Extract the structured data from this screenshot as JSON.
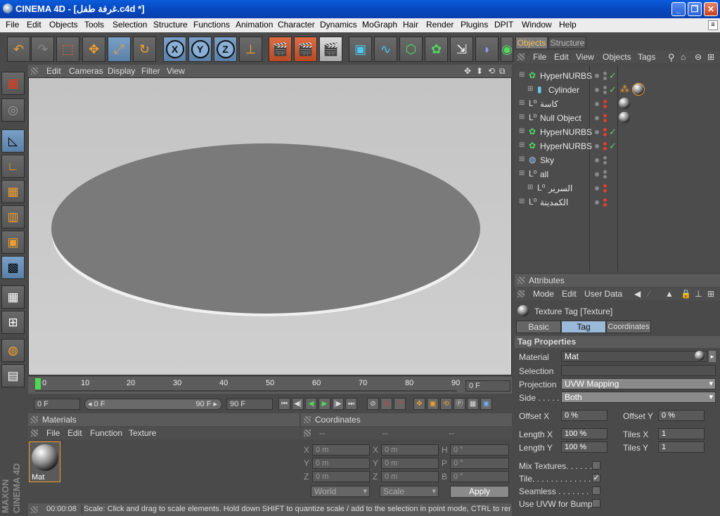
{
  "window": {
    "title": "CINEMA 4D - [غرفة طفل.c4d *]",
    "min": "_",
    "max": "❐",
    "close": "✕"
  },
  "menu": [
    "File",
    "Edit",
    "Objects",
    "Tools",
    "Selection",
    "Structure",
    "Functions",
    "Animation",
    "Character",
    "Dynamics",
    "MoGraph",
    "Hair",
    "Render",
    "Plugins",
    "DPIT",
    "Window",
    "Help"
  ],
  "menu_mini": "≡",
  "toolbar": {
    "undo": "↶",
    "redo": "↷",
    "select": "⬚",
    "move": "✥",
    "scale": "⤢",
    "rotate": "↻",
    "x": "X",
    "y": "Y",
    "z": "Z",
    "coord": "⊥",
    "render1": "🎬",
    "render2": "🎬",
    "render3": "🎬",
    "cube": "▣",
    "spline": "∿",
    "nurbs": "⬡",
    "array": "✿",
    "deformer": "⇲",
    "scene": "◗",
    "more": "◉"
  },
  "lefttools": [
    "▦",
    "◎",
    "◺",
    "∟",
    "▦",
    "▥",
    "▣",
    "▩",
    "▦",
    "⊞",
    "◍",
    "▤"
  ],
  "branding": "MAXON CINEMA 4D",
  "viewport": {
    "menu": [
      "Edit",
      "Cameras",
      "Display",
      "Filter",
      "View"
    ],
    "controls": [
      "✥",
      "⬍",
      "⟲",
      "⧉"
    ]
  },
  "timeline": {
    "ticks": [
      "0",
      "10",
      "20",
      "30",
      "40",
      "50",
      "60",
      "70",
      "80",
      "90"
    ],
    "current": "0 F"
  },
  "playbar": {
    "start": "0 F",
    "slider_left": "◂ 0 F",
    "slider_right": "90 F ▸",
    "end": "90 F",
    "buttons": [
      "⏮",
      "◀|",
      "◀",
      "▶",
      "|▶",
      "⏭"
    ],
    "rec": [
      "⊘",
      "⊙",
      "?"
    ],
    "keys": [
      "✥",
      "▣",
      "⟲",
      "Ⓟ",
      "▦",
      "▣"
    ]
  },
  "materials": {
    "title": "Materials",
    "menu": [
      "File",
      "Edit",
      "Function",
      "Texture"
    ],
    "items": [
      {
        "name": "Mat"
      }
    ]
  },
  "coordinates": {
    "title": "Coordinates",
    "col_heads": [
      "--",
      "--",
      "--"
    ],
    "rows": [
      {
        "a": "X",
        "av": "0 m",
        "b": "X",
        "bv": "0 m",
        "c": "H",
        "cv": "0 °"
      },
      {
        "a": "Y",
        "av": "0 m",
        "b": "Y",
        "bv": "0 m",
        "c": "P",
        "cv": "0 °"
      },
      {
        "a": "Z",
        "av": "0 m",
        "b": "Z",
        "bv": "0 m",
        "c": "B",
        "cv": "0 °"
      }
    ],
    "world": "World",
    "scale": "Scale",
    "apply": "Apply"
  },
  "status": {
    "time": "00:00:08",
    "text": "Scale: Click and drag to scale elements. Hold down SHIFT to quantize scale / add to the selection in point mode, CTRL to remove"
  },
  "objects": {
    "tabs": [
      "Objects",
      "Structure"
    ],
    "menu": [
      "File",
      "Edit",
      "View",
      "Objects",
      "Tags"
    ],
    "rows": [
      {
        "name": "HyperNURBS",
        "indent": 0,
        "icon": "nurbs",
        "dot": "grey",
        "check": "✓",
        "tags": 0
      },
      {
        "name": "Cylinder",
        "indent": 1,
        "icon": "cyl",
        "dot": "grey",
        "check": "✓",
        "tags": 2
      },
      {
        "name": "كاسة",
        "indent": 0,
        "icon": "null",
        "dot": "red",
        "check": "",
        "tags": 1
      },
      {
        "name": "Null Object",
        "indent": 0,
        "icon": "null",
        "dot": "red",
        "check": "",
        "tags": 1
      },
      {
        "name": "HyperNURBS",
        "indent": 0,
        "icon": "nurbs",
        "dot": "red",
        "check": "✓",
        "tags": 0
      },
      {
        "name": "HyperNURBS",
        "indent": 0,
        "icon": "nurbs",
        "dot": "red",
        "check": "✓",
        "tags": 0
      },
      {
        "name": "Sky",
        "indent": 0,
        "icon": "sky",
        "dot": "grey",
        "check": "",
        "tags": 0
      },
      {
        "name": "all",
        "indent": 0,
        "icon": "null",
        "dot": "grey",
        "check": "",
        "tags": 0
      },
      {
        "name": "السرير",
        "indent": 1,
        "icon": "null",
        "dot": "red",
        "check": "",
        "tags": 0
      },
      {
        "name": "الكمدينة",
        "indent": 0,
        "icon": "null",
        "dot": "red",
        "check": "",
        "tags": 0
      }
    ]
  },
  "attributes": {
    "title": "Attributes",
    "menu": [
      "Mode",
      "Edit",
      "User Data"
    ],
    "object": "Texture Tag [Texture]",
    "tabs": [
      "Basic",
      "Tag",
      "Coordinates"
    ],
    "section": "Tag Properties",
    "material_label": "Material",
    "material_value": "Mat",
    "selection_label": "Selection",
    "projection_label": "Projection",
    "projection_value": "UVW Mapping",
    "side_label": "Side . . . . .",
    "side_value": "Both",
    "offx_label": "Offset X",
    "offx": "0 %",
    "offy_label": "Offset Y",
    "offy": "0 %",
    "lenx_label": "Length X",
    "lenx": "100 %",
    "tilesx_label": "Tiles X",
    "tilesx": "1",
    "leny_label": "Length Y",
    "leny": "100 %",
    "tilesy_label": "Tiles Y",
    "tilesy": "1",
    "checks": [
      {
        "label": "Mix Textures. . . . . .",
        "on": ""
      },
      {
        "label": "Tile. . . . . . . . . . . . .",
        "on": "✓"
      },
      {
        "label": "Seamless . . . . . . . .",
        "on": ""
      },
      {
        "label": "Use UVW for Bump",
        "on": ""
      }
    ]
  }
}
